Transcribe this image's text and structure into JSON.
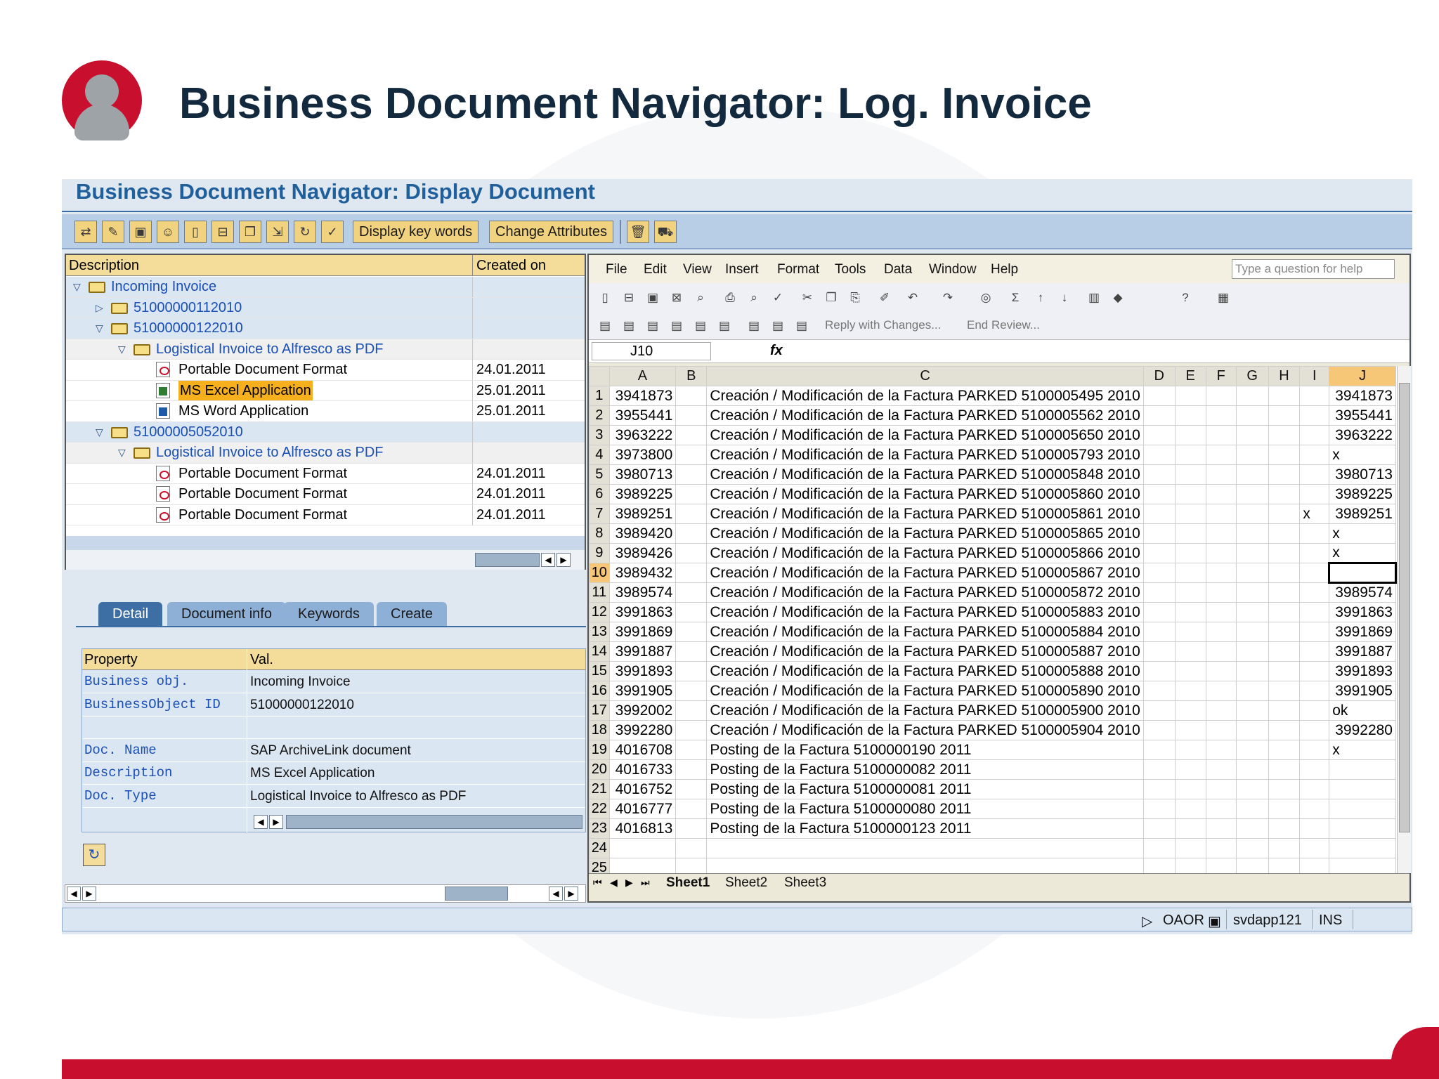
{
  "slide": {
    "title": "Business Document Navigator: Log. Invoice"
  },
  "window": {
    "title": "Business Document Navigator: Display Document"
  },
  "toolbar": {
    "icons": [
      "display-change-icon",
      "pencil-icon",
      "save-icon",
      "user-icon",
      "new-document-icon",
      "folder-open-icon",
      "copy-icon",
      "import-icon",
      "refresh-icon",
      "check-icon"
    ],
    "display_key_words": "Display key words",
    "change_attributes": "Change Attributes",
    "trailing_icons": [
      "trash-icon",
      "transport-icon"
    ]
  },
  "tree": {
    "col_description": "Description",
    "col_created": "Created on",
    "rows": [
      {
        "label": "Incoming Invoice",
        "date": "",
        "level": 0,
        "type": "folder",
        "expanded": true,
        "style": "blue",
        "link": true
      },
      {
        "label": "51000000112010",
        "date": "",
        "level": 1,
        "type": "folder",
        "expanded": false,
        "style": "blue",
        "link": true
      },
      {
        "label": "51000000122010",
        "date": "",
        "level": 1,
        "type": "folder",
        "expanded": true,
        "style": "blue",
        "link": true
      },
      {
        "label": "Logistical Invoice to Alfresco as PDF",
        "date": "",
        "level": 2,
        "type": "folder",
        "expanded": true,
        "style": "grey",
        "link": true
      },
      {
        "label": "Portable Document Format",
        "date": "24.01.2011",
        "level": 3,
        "type": "pdf",
        "style": "white"
      },
      {
        "label": "MS Excel Application",
        "date": "25.01.2011",
        "level": 3,
        "type": "xls",
        "style": "white",
        "highlight": true
      },
      {
        "label": "MS Word Application",
        "date": "25.01.2011",
        "level": 3,
        "type": "doc",
        "style": "white"
      },
      {
        "label": "51000005052010",
        "date": "",
        "level": 1,
        "type": "folder",
        "expanded": true,
        "style": "blue",
        "link": true
      },
      {
        "label": "Logistical Invoice to Alfresco as PDF",
        "date": "",
        "level": 2,
        "type": "folder",
        "expanded": true,
        "style": "grey",
        "link": true
      },
      {
        "label": "Portable Document Format",
        "date": "24.01.2011",
        "level": 3,
        "type": "pdf",
        "style": "white"
      },
      {
        "label": "Portable Document Format",
        "date": "24.01.2011",
        "level": 3,
        "type": "pdf",
        "style": "white"
      },
      {
        "label": "Portable Document Format",
        "date": "24.01.2011",
        "level": 3,
        "type": "pdf",
        "style": "white"
      }
    ]
  },
  "tabs": [
    "Detail",
    "Document info",
    "Keywords",
    "Create"
  ],
  "properties": {
    "col_property": "Property",
    "col_value": "Val.",
    "rows": [
      {
        "key": "Business obj.",
        "value": "Incoming Invoice"
      },
      {
        "key": "BusinessObject ID",
        "value": "51000000122010"
      },
      {
        "key": "",
        "value": ""
      },
      {
        "key": "Doc. Name",
        "value": "SAP ArchiveLink document"
      },
      {
        "key": "Description",
        "value": "MS Excel Application"
      },
      {
        "key": "Doc. Type",
        "value": "Logistical Invoice to Alfresco as PDF"
      }
    ]
  },
  "excel": {
    "menu": [
      "File",
      "Edit",
      "View",
      "Insert",
      "Format",
      "Tools",
      "Data",
      "Window",
      "Help"
    ],
    "help_placeholder": "Type a question for help",
    "reply_with_changes": "Reply with Changes...",
    "end_review": "End Review...",
    "name_box": "J10",
    "fx": "fx",
    "columns": [
      "A",
      "B",
      "C",
      "D",
      "E",
      "F",
      "G",
      "H",
      "I",
      "J"
    ],
    "active_cell": "J10",
    "rows": [
      {
        "n": "1",
        "a": "3941873",
        "c": "Creación / Modificación de la Factura PARKED 5100005495 2010",
        "i": "",
        "j": "3941873"
      },
      {
        "n": "2",
        "a": "3955441",
        "c": "Creación / Modificación de la Factura PARKED 5100005562 2010",
        "i": "",
        "j": "3955441"
      },
      {
        "n": "3",
        "a": "3963222",
        "c": "Creación / Modificación de la Factura PARKED 5100005650 2010",
        "i": "",
        "j": "3963222"
      },
      {
        "n": "4",
        "a": "3973800",
        "c": "Creación / Modificación de la Factura PARKED 5100005793 2010",
        "i": "",
        "j": "x"
      },
      {
        "n": "5",
        "a": "3980713",
        "c": "Creación / Modificación de la Factura PARKED 5100005848 2010",
        "i": "",
        "j": "3980713"
      },
      {
        "n": "6",
        "a": "3989225",
        "c": "Creación / Modificación de la Factura PARKED 5100005860 2010",
        "i": "",
        "j": "3989225"
      },
      {
        "n": "7",
        "a": "3989251",
        "c": "Creación / Modificación de la Factura PARKED 5100005861 2010",
        "i": "x",
        "j": "3989251"
      },
      {
        "n": "8",
        "a": "3989420",
        "c": "Creación / Modificación de la Factura PARKED 5100005865 2010",
        "i": "",
        "j": "x"
      },
      {
        "n": "9",
        "a": "3989426",
        "c": "Creación / Modificación de la Factura PARKED 5100005866 2010",
        "i": "",
        "j": "x"
      },
      {
        "n": "10",
        "a": "3989432",
        "c": "Creación / Modificación de la Factura PARKED 5100005867 2010",
        "i": "",
        "j": ""
      },
      {
        "n": "11",
        "a": "3989574",
        "c": "Creación / Modificación de la Factura PARKED 5100005872 2010",
        "i": "",
        "j": "3989574"
      },
      {
        "n": "12",
        "a": "3991863",
        "c": "Creación / Modificación de la Factura PARKED 5100005883 2010",
        "i": "",
        "j": "3991863"
      },
      {
        "n": "13",
        "a": "3991869",
        "c": "Creación / Modificación de la Factura PARKED 5100005884 2010",
        "i": "",
        "j": "3991869"
      },
      {
        "n": "14",
        "a": "3991887",
        "c": "Creación / Modificación de la Factura PARKED 5100005887 2010",
        "i": "",
        "j": "3991887"
      },
      {
        "n": "15",
        "a": "3991893",
        "c": "Creación / Modificación de la Factura PARKED 5100005888 2010",
        "i": "",
        "j": "3991893"
      },
      {
        "n": "16",
        "a": "3991905",
        "c": "Creación / Modificación de la Factura PARKED 5100005890 2010",
        "i": "",
        "j": "3991905"
      },
      {
        "n": "17",
        "a": "3992002",
        "c": "Creación / Modificación de la Factura PARKED 5100005900 2010",
        "i": "",
        "j": "ok"
      },
      {
        "n": "18",
        "a": "3992280",
        "c": "Creación / Modificación de la Factura PARKED 5100005904 2010",
        "i": "",
        "j": "3992280"
      },
      {
        "n": "19",
        "a": "4016708",
        "c": "Posting de la Factura 5100000190 2011",
        "i": "",
        "j": "x"
      },
      {
        "n": "20",
        "a": "4016733",
        "c": "Posting de la Factura 5100000082 2011",
        "i": "",
        "j": ""
      },
      {
        "n": "21",
        "a": "4016752",
        "c": "Posting de la Factura 5100000081 2011",
        "i": "",
        "j": ""
      },
      {
        "n": "22",
        "a": "4016777",
        "c": "Posting de la Factura 5100000080 2011",
        "i": "",
        "j": ""
      },
      {
        "n": "23",
        "a": "4016813",
        "c": "Posting de la Factura 5100000123 2011",
        "i": "",
        "j": ""
      },
      {
        "n": "24",
        "a": "",
        "c": "",
        "i": "",
        "j": ""
      },
      {
        "n": "25",
        "a": "",
        "c": "",
        "i": "",
        "j": ""
      }
    ],
    "sheets": [
      "Sheet1",
      "Sheet2",
      "Sheet3"
    ],
    "active_sheet": "Sheet1"
  },
  "status": {
    "mode1": "OAOR",
    "server": "svdapp121",
    "mode2": "INS"
  },
  "colors": {
    "brand_red": "#c8102e",
    "title_navy": "#13293d",
    "sap_blue": "#1f5f9c",
    "highlight": "#f6b01e"
  }
}
